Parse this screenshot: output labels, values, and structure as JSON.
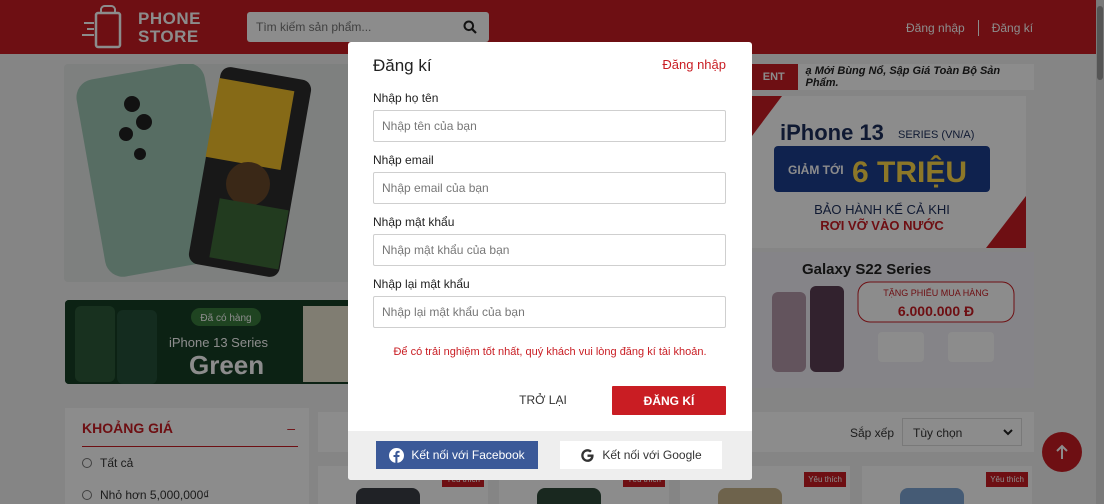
{
  "header": {
    "logo_line1": "PHONE",
    "logo_line2": "STORE",
    "search_placeholder": "Tìm kiếm sản phẩm...",
    "login_link": "Đăng nhập",
    "register_link": "Đăng kí"
  },
  "ticker": {
    "tag": "ENT",
    "text": "ạ Mới Bùng Nổ, Sập Giá Toàn Bộ Sản Phẩm."
  },
  "banners": {
    "iphone13_title": "iPhone 13",
    "iphone13_series": "SERIES (VN/A)",
    "iphone13_discount_prefix": "GIẢM TỚI",
    "iphone13_discount": "6 TRIỆU",
    "iphone13_line1": "BẢO HÀNH KỂ CẢ KHI",
    "iphone13_line2": "RƠI VỠ VÀO NƯỚC",
    "galaxy_title": "Galaxy S22 Series",
    "galaxy_voucher": "TẶNG PHIẾU MUA HÀNG",
    "galaxy_amount": "6.000.000 Đ",
    "green_badge": "Đã có hàng",
    "green_series": "iPhone 13 Series",
    "green_word": "Green"
  },
  "filter": {
    "title": "KHOẢNG GIÁ",
    "toggle": "–",
    "options": [
      "Tất cả",
      "Nhỏ hơn 5,000,000₫"
    ]
  },
  "sort": {
    "label": "Sắp xếp",
    "selected": "Tùy chọn"
  },
  "cards": {
    "tag": "Yêu thích"
  },
  "modal": {
    "title": "Đăng kí",
    "switch_link": "Đăng nhập",
    "fields": [
      {
        "label": "Nhập họ tên",
        "placeholder": "Nhập tên của bạn"
      },
      {
        "label": "Nhập email",
        "placeholder": "Nhập email của bạn"
      },
      {
        "label": "Nhập mật khẩu",
        "placeholder": "Nhập mật khẩu của bạn"
      },
      {
        "label": "Nhập lại mật khẩu",
        "placeholder": "Nhập lại mật khẩu của bạn"
      }
    ],
    "notice": "Để có trải nghiệm tốt nhất, quý khách vui lòng đăng kí tài khoản.",
    "back_button": "TRỞ LẠI",
    "register_button": "ĐĂNG KÍ",
    "facebook_button": "Kết nối với Facebook",
    "google_button": "Kết nối với Google"
  },
  "colors": {
    "brand_red": "#c91d23",
    "facebook_blue": "#3b5998"
  }
}
